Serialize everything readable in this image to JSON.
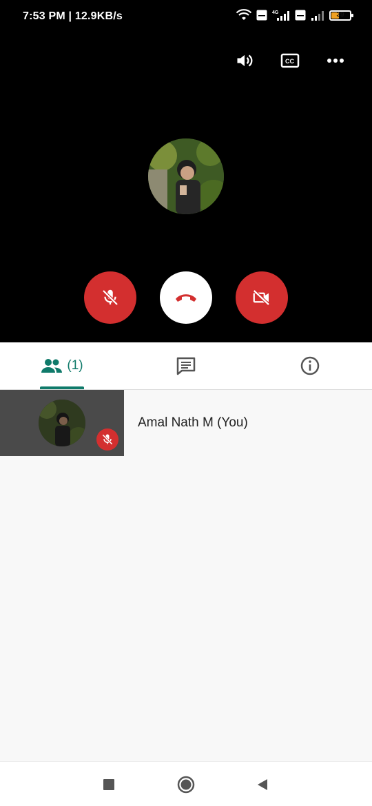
{
  "status_bar": {
    "time": "7:53 PM | 12.9KB/s",
    "network_1": "4G",
    "volte_label": "Vo LTE",
    "battery_level": "39",
    "battery_fraction": 0.39
  },
  "top_actions": {
    "icons": [
      "speaker-icon",
      "closed-captions-icon",
      "more-options-icon"
    ]
  },
  "call_controls": {
    "icons": [
      "mic-off-icon",
      "end-call-icon",
      "video-off-icon"
    ],
    "colors": {
      "mute": "#d32f2f",
      "end_call_bg": "#ffffff",
      "end_call_icon": "#d32f2f",
      "video_off": "#d32f2f"
    }
  },
  "tabs": {
    "participants_count": "(1)",
    "accent": "#0f7a6a",
    "icons": [
      "people-icon",
      "chat-icon",
      "info-icon"
    ]
  },
  "participants": [
    {
      "name": "Amal Nath M (You)",
      "muted": true
    }
  ],
  "nav": {
    "icons": [
      "recents-square-icon",
      "home-circle-icon",
      "back-triangle-icon"
    ]
  }
}
